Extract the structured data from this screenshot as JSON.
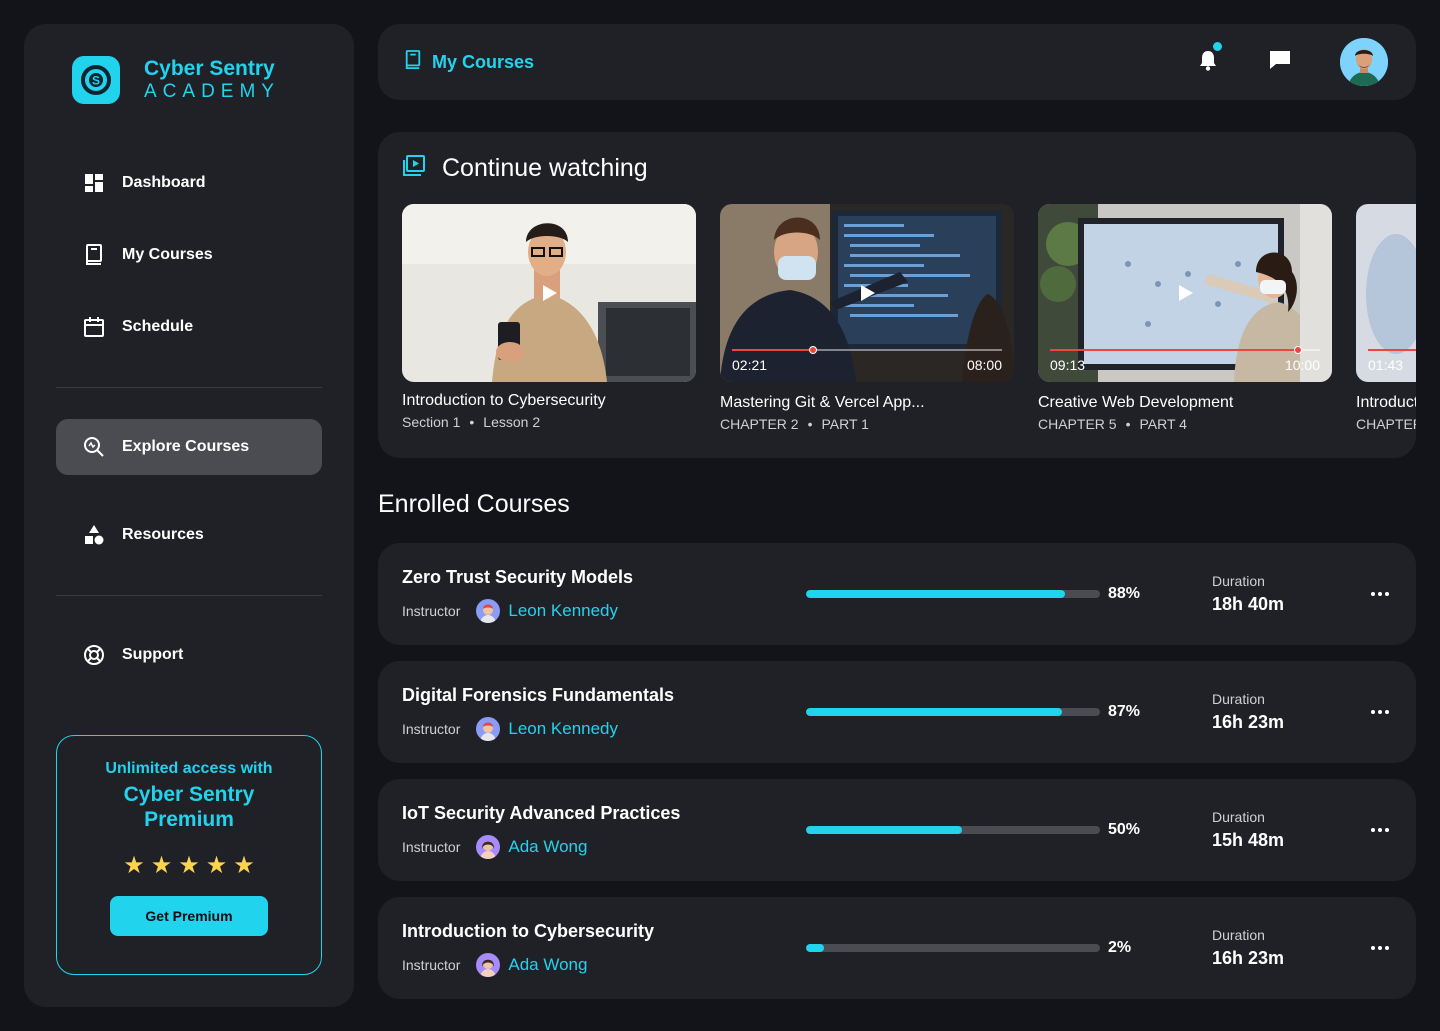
{
  "brand": {
    "name": "Cyber Sentry",
    "sub": "ACADEMY",
    "accent": "#22d3ee"
  },
  "nav": [
    {
      "label": "Dashboard",
      "icon": "dashboard-icon"
    },
    {
      "label": "My Courses",
      "icon": "book-icon"
    },
    {
      "label": "Schedule",
      "icon": "calendar-icon"
    },
    {
      "label": "Explore Courses",
      "icon": "search-icon",
      "active": true
    },
    {
      "label": "Resources",
      "icon": "shapes-icon"
    },
    {
      "label": "Support",
      "icon": "lifebuoy-icon"
    }
  ],
  "promo": {
    "line1": "Unlimited access with",
    "line2": "Cyber Sentry",
    "line3": "Premium",
    "stars": 5,
    "button": "Get Premium"
  },
  "header": {
    "title": "My Courses",
    "has_notification": true
  },
  "continue": {
    "title": "Continue watching",
    "videos": [
      {
        "title": "Introduction to Cybersecurity",
        "meta1": "Section 1",
        "meta2": "Lesson 2",
        "time": "",
        "duration": "",
        "progress": null
      },
      {
        "title": "Mastering Git & Vercel App...",
        "meta1": "CHAPTER 2",
        "meta2": "PART 1",
        "time": "02:21",
        "duration": "08:00",
        "progress": 0.3
      },
      {
        "title": "Creative Web Development",
        "meta1": "CHAPTER 5",
        "meta2": "PART 4",
        "time": "09:13",
        "duration": "10:00",
        "progress": 0.92
      },
      {
        "title": "Introduction to Cybersecurity",
        "meta1": "CHAPTER",
        "meta2": "",
        "time": "01:43",
        "duration": "",
        "progress": 0.4
      }
    ]
  },
  "enrolled": {
    "title": "Enrolled Courses",
    "instructor_label": "Instructor",
    "duration_label": "Duration",
    "courses": [
      {
        "name": "Zero Trust Security Models",
        "instructor": "Leon Kennedy",
        "progress": 88,
        "progress_label": "88%",
        "duration": "18h 40m"
      },
      {
        "name": "Digital Forensics Fundamentals",
        "instructor": "Leon Kennedy",
        "progress": 87,
        "progress_label": "87%",
        "duration": "16h 23m"
      },
      {
        "name": "IoT Security Advanced Practices",
        "instructor": "Ada Wong",
        "progress": 50,
        "progress_label": "50%",
        "duration": "15h 48m"
      },
      {
        "name": "Introduction to Cybersecurity",
        "instructor": "Ada Wong",
        "progress": 2,
        "progress_label": "2%",
        "duration": "16h 23m"
      }
    ]
  }
}
